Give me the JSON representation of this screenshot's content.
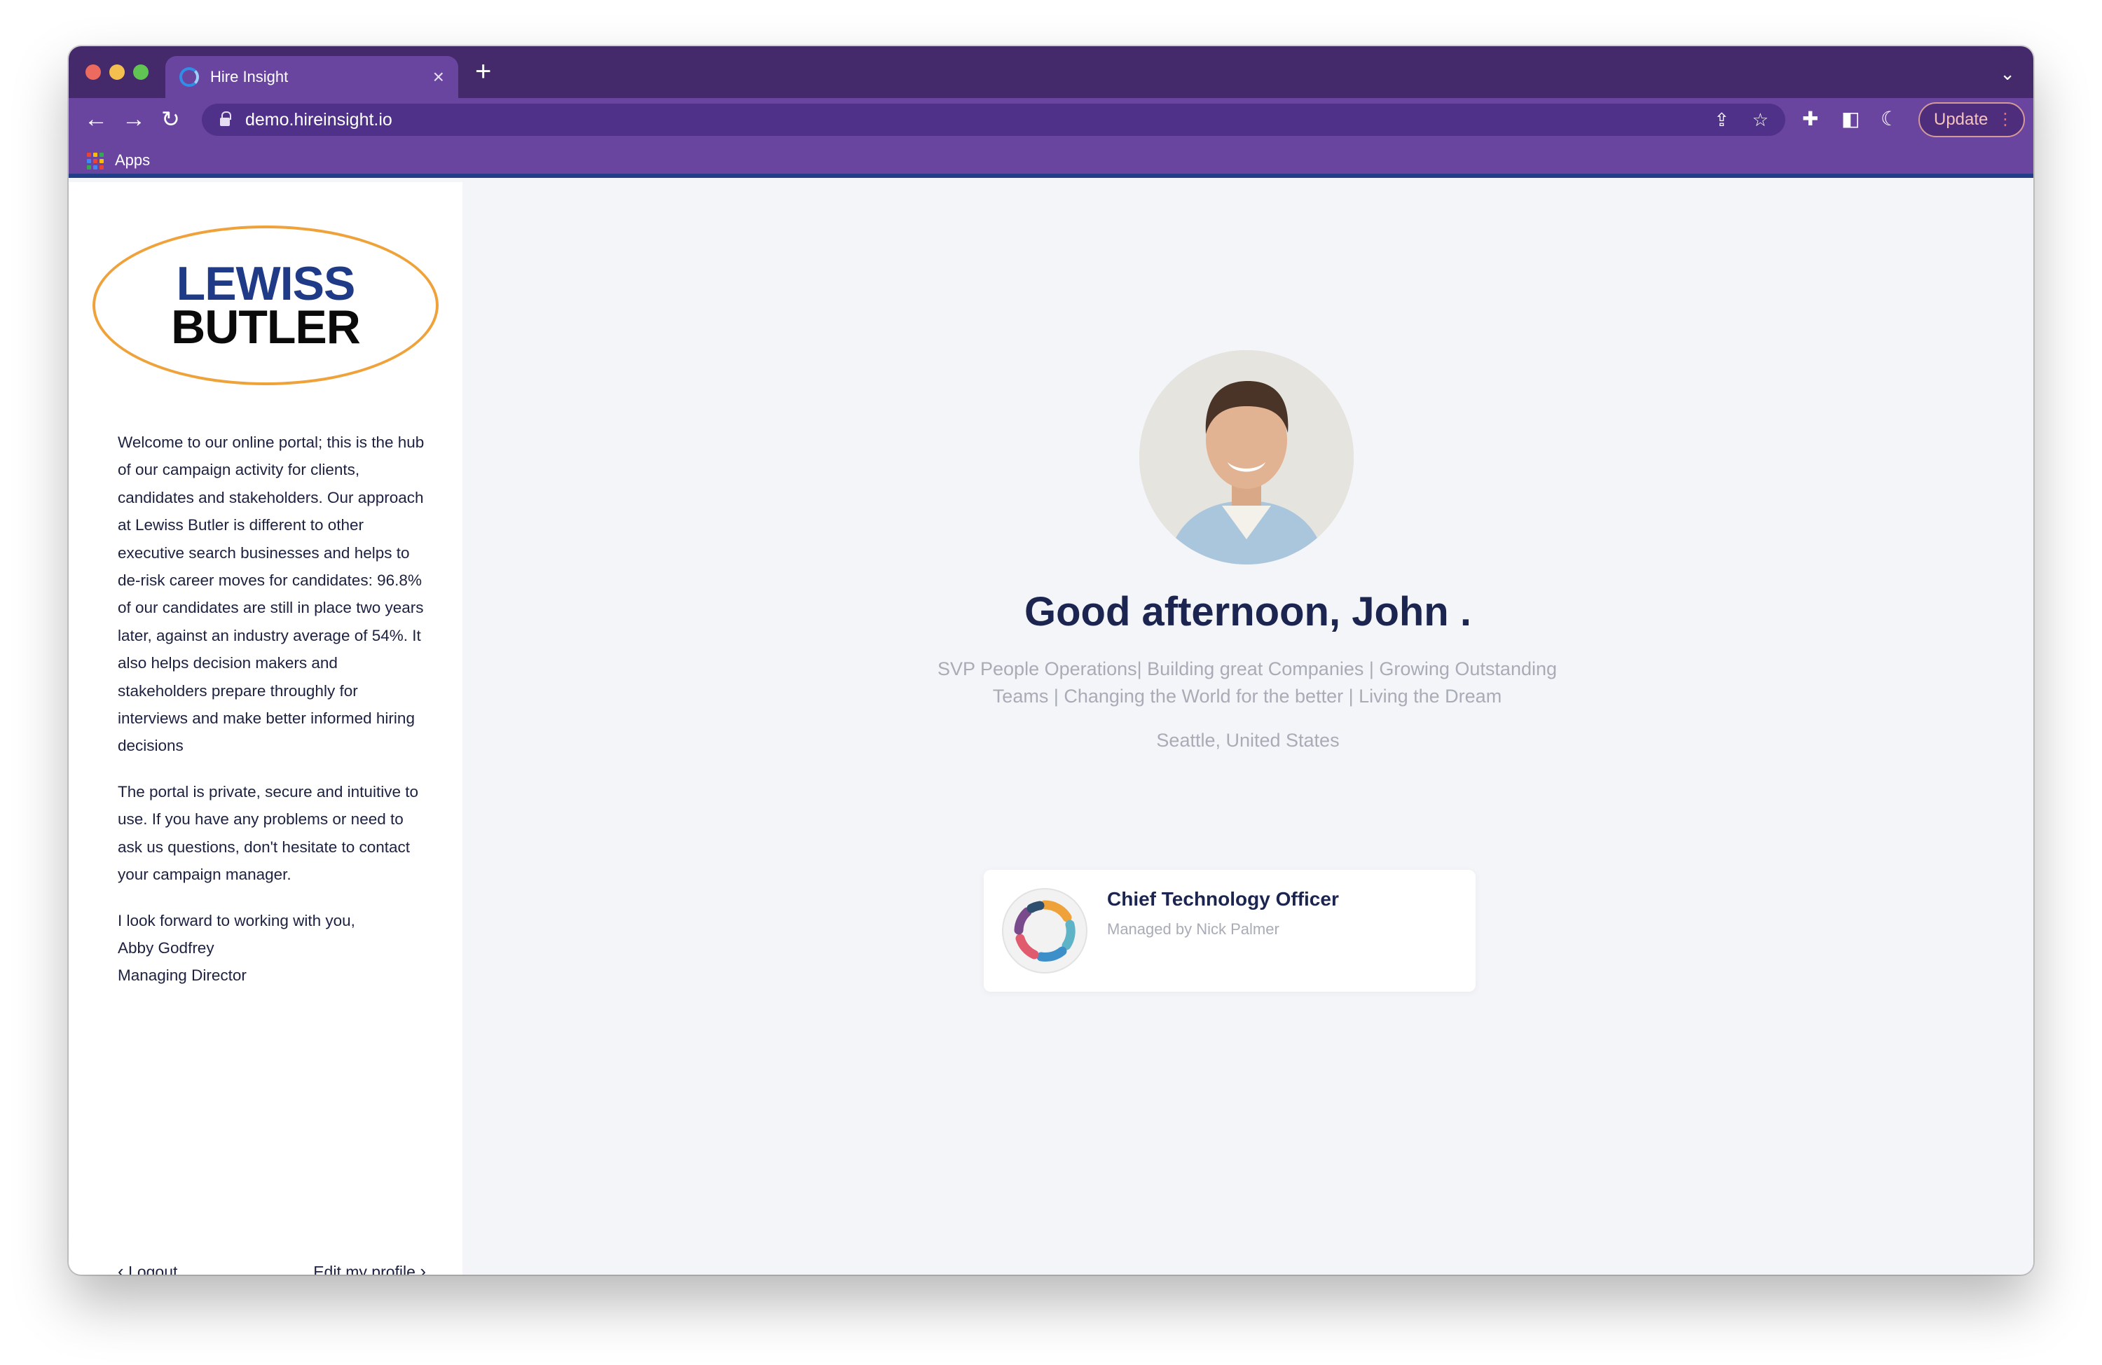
{
  "browser": {
    "tab_title": "Hire Insight",
    "url": "demo.hireinsight.io",
    "update_label": "Update",
    "bookmarks": [
      {
        "label": "Apps"
      }
    ]
  },
  "sidebar": {
    "logo": {
      "line1": "LEWISS",
      "line2": "BUTLER",
      "line1_color": "#1f3b87",
      "oval_color": "#f0a23a"
    },
    "intro_paragraphs": [
      "Welcome to our online portal; this is the hub of our campaign activity for clients, candidates and stakeholders. Our approach at Lewiss Butler is different to other executive search businesses and helps to de-risk career moves for candidates: 96.8% of our candidates are still in place two years later, against an industry average of 54%. It also helps decision makers and stakeholders prepare throughly for interviews and make better informed hiring decisions",
      "The portal is private, secure and intuitive to use. If you have any problems or need to ask us questions, don't hesitate to contact your campaign manager."
    ],
    "signoff": {
      "line1": "I look forward to working with you,",
      "name": "Abby Godfrey",
      "title": "Managing Director"
    },
    "logout_label": "Logout",
    "edit_profile_label": "Edit my profile"
  },
  "profile": {
    "greeting": "Good afternoon, John .",
    "headline": "SVP People Operations| Building great Companies | Growing Outstanding Teams | Changing the World for the better | Living the Dream",
    "location": "Seattle, United States"
  },
  "campaigns": [
    {
      "title": "Chief Technology Officer",
      "manager": "Managed by Nick Palmer"
    }
  ],
  "theme": {
    "toolbar": "#6a45a0",
    "tabstrip": "#442a6b",
    "accent_line": "#223e88",
    "text_dark": "#1b2550",
    "text_muted": "#a9acb6"
  }
}
